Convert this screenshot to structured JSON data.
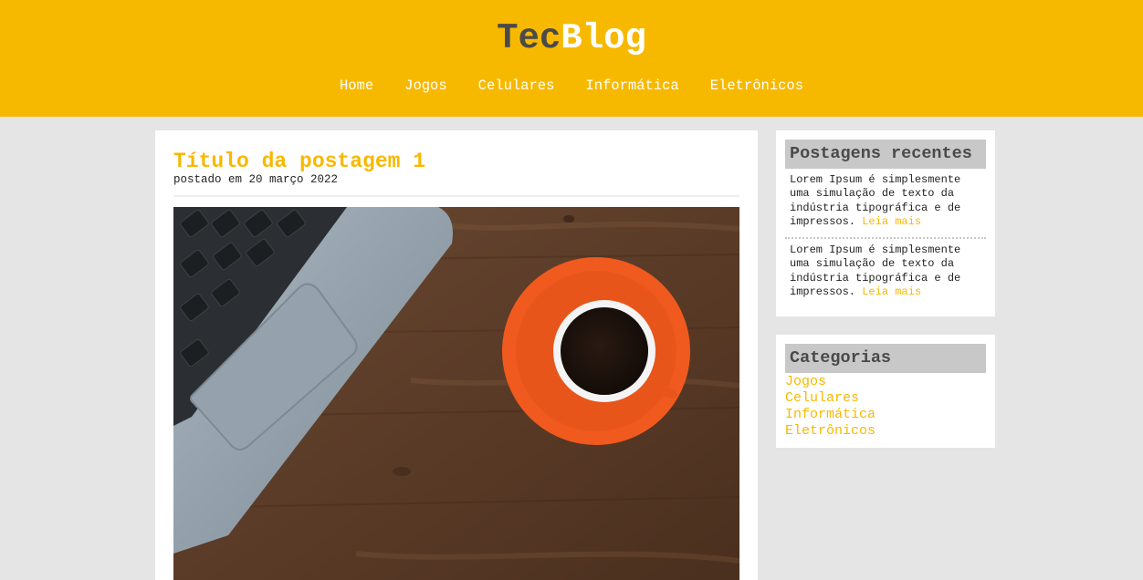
{
  "brand": {
    "part1": "Tec",
    "part2": "Blog"
  },
  "nav": [
    {
      "label": "Home"
    },
    {
      "label": "Jogos"
    },
    {
      "label": "Celulares"
    },
    {
      "label": "Informática"
    },
    {
      "label": "Eletrônicos"
    }
  ],
  "post": {
    "title": "Título da postagem 1",
    "date": "postado em 20 março 2022"
  },
  "recent": {
    "title": "Postagens recentes",
    "items": [
      {
        "text": "Lorem Ipsum é simplesmente uma simulação de texto da indústria tipográfica e de impressos.",
        "link": "Leia mais"
      },
      {
        "text": "Lorem Ipsum é simplesmente uma simulação de texto da indústria tipográfica e de impressos.",
        "link": "Leia mais"
      }
    ]
  },
  "categories": {
    "title": "Categorias",
    "items": [
      {
        "label": "Jogos"
      },
      {
        "label": "Celulares"
      },
      {
        "label": "Informática"
      },
      {
        "label": "Eletrônicos"
      }
    ]
  },
  "colors": {
    "accent": "#f7b900",
    "dark": "#4a4a4a",
    "widget_header": "#c8c8c8",
    "background": "#e5e5e5"
  }
}
